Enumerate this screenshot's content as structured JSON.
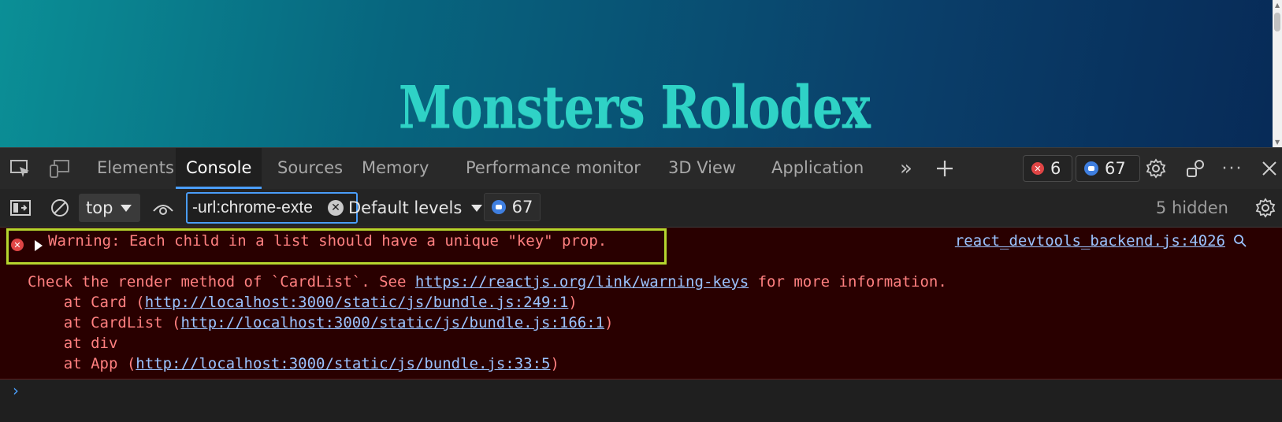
{
  "page": {
    "title": "Monsters Rolodex"
  },
  "devtools": {
    "tabs": [
      {
        "label": "Elements",
        "active": false
      },
      {
        "label": "Console",
        "active": true
      },
      {
        "label": "Sources",
        "active": false
      },
      {
        "label": "Memory",
        "active": false
      },
      {
        "label": "Performance monitor",
        "active": false
      },
      {
        "label": "3D View",
        "active": false
      },
      {
        "label": "Application",
        "active": false
      }
    ],
    "error_count": "6",
    "message_count": "67",
    "icons": {
      "inspect": "inspect-element-icon",
      "device": "device-toolbar-icon",
      "more_tabs": "chevrons-right-icon",
      "add_tab": "plus-icon",
      "settings": "gear-icon",
      "customize": "customize-icon",
      "more": "ellipsis-icon",
      "close": "close-icon"
    }
  },
  "toolbar": {
    "context": "top",
    "filter_value": "-url:chrome-exte",
    "levels": "Default levels",
    "msg_count": "67",
    "hidden": "5 hidden"
  },
  "console": {
    "warning": "Warning: Each child in a list should have a unique \"key\" prop.",
    "source": "react_devtools_backend.js:4026",
    "check_prefix": "Check the render method of `CardList`. See ",
    "check_link": "https://reactjs.org/link/warning-keys",
    "check_suffix": " for more information.",
    "stack": [
      {
        "prefix": "    at Card (",
        "link": "http://localhost:3000/static/js/bundle.js:249:1",
        "suffix": ")"
      },
      {
        "prefix": "    at CardList (",
        "link": "http://localhost:3000/static/js/bundle.js:166:1",
        "suffix": ")"
      },
      {
        "prefix": "    at div",
        "link": "",
        "suffix": ""
      },
      {
        "prefix": "    at App (",
        "link": "http://localhost:3000/static/js/bundle.js:33:5",
        "suffix": ")"
      }
    ]
  },
  "colors": {
    "accent": "#4a9df8",
    "error_bg": "#290000",
    "error_text": "#ff8080",
    "highlight": "#b5d62e",
    "title": "#2fd2c6"
  }
}
